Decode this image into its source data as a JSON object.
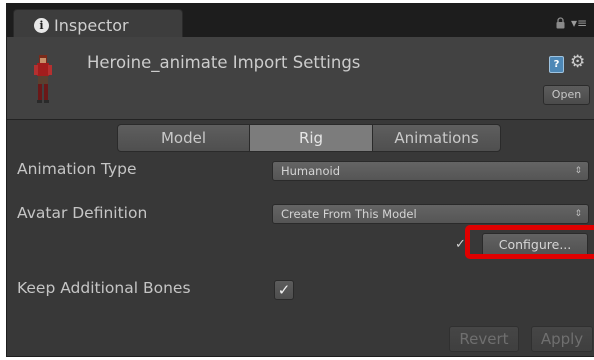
{
  "tab": {
    "label": "Inspector",
    "info_icon": "i"
  },
  "header": {
    "title": "Heroine_animate Import Settings",
    "help_icon": "?",
    "settings_icon": "⚙",
    "open_label": "Open"
  },
  "segments": {
    "model": "Model",
    "rig": "Rig",
    "animations": "Animations",
    "selected": "Rig"
  },
  "fields": {
    "animation_type_label": "Animation Type",
    "animation_type_value": "Humanoid",
    "avatar_definition_label": "Avatar Definition",
    "avatar_definition_value": "Create From This Model",
    "configure_check": "✓",
    "configure_label": "Configure...",
    "keep_bones_label": "Keep Additional Bones",
    "keep_bones_checked": true,
    "keep_bones_mark": "✓"
  },
  "footer": {
    "revert_label": "Revert",
    "apply_label": "Apply"
  },
  "icons": {
    "lock": "lock-icon",
    "menu": "tab-menu-icon",
    "help": "help-book-icon",
    "gear": "gear-icon",
    "dropdown": "updown-arrows-icon"
  },
  "colors": {
    "panel_bg": "#383838",
    "header_bg": "#424242",
    "tab_bar_bg": "#1d1d1d",
    "selected_segment": "#7c7c7c",
    "highlight": "#e00000"
  }
}
